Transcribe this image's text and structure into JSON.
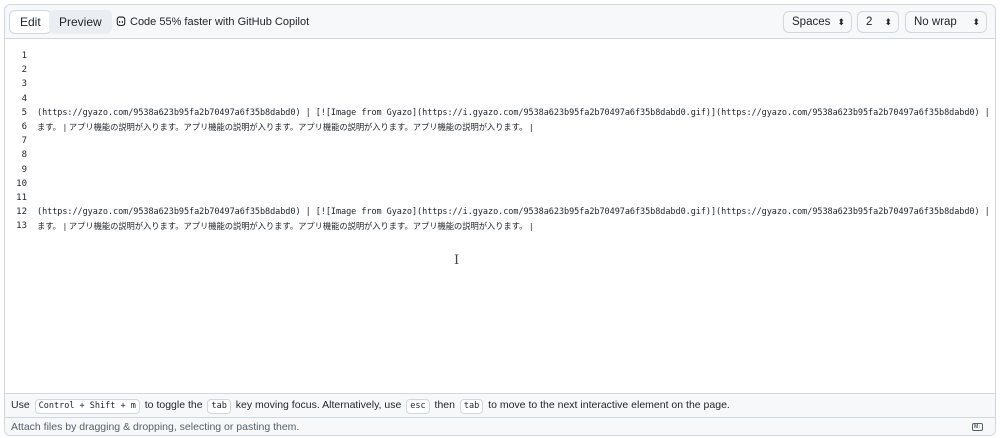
{
  "tabs": {
    "edit": "Edit",
    "preview": "Preview"
  },
  "copilot": {
    "label": "Code 55% faster with GitHub Copilot",
    "icon": "copilot-icon"
  },
  "selects": {
    "indent_mode": "Spaces",
    "indent_size": "2",
    "wrap_mode": "No wrap"
  },
  "editor": {
    "lines": [
      {
        "n": "1",
        "text": ""
      },
      {
        "n": "2",
        "text": ""
      },
      {
        "n": "3",
        "text": ""
      },
      {
        "n": "4",
        "text": ""
      },
      {
        "n": "5",
        "text": "(https://gyazo.com/9538a623b95fa2b70497a6f35b8dabd0) | [![Image from Gyazo](https://i.gyazo.com/9538a623b95fa2b70497a6f35b8dabd0.gif)](https://gyazo.com/9538a623b95fa2b70497a6f35b8dabd0) |"
      },
      {
        "n": "6",
        "text": "ます。 | アプリ機能の説明が入ります。アプリ機能の説明が入ります。アプリ機能の説明が入ります。アプリ機能の説明が入ります。 |"
      },
      {
        "n": "7",
        "text": ""
      },
      {
        "n": "8",
        "text": ""
      },
      {
        "n": "9",
        "text": ""
      },
      {
        "n": "10",
        "text": ""
      },
      {
        "n": "11",
        "text": ""
      },
      {
        "n": "12",
        "text": "(https://gyazo.com/9538a623b95fa2b70497a6f35b8dabd0) | [![Image from Gyazo](https://i.gyazo.com/9538a623b95fa2b70497a6f35b8dabd0.gif)](https://gyazo.com/9538a623b95fa2b70497a6f35b8dabd0) |"
      },
      {
        "n": "13",
        "text": "ます。 | アプリ機能の説明が入ります。アプリ機能の説明が入ります。アプリ機能の説明が入ります。アプリ機能の説明が入ります。 |"
      }
    ]
  },
  "hint": {
    "p1": "Use",
    "k1": "Control + Shift + m",
    "p2": "to toggle the",
    "k2": "tab",
    "p3": "key moving focus. Alternatively, use",
    "k3": "esc",
    "p4": "then",
    "k4": "tab",
    "p5": "to move to the next interactive element on the page."
  },
  "attach": {
    "text": "Attach files by dragging & dropping, selecting or pasting them.",
    "icon": "markdown-icon"
  }
}
